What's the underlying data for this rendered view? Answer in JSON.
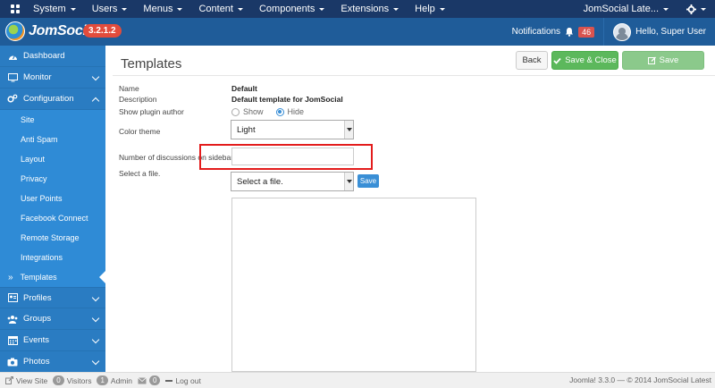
{
  "topmenu": {
    "items": [
      {
        "label": "System"
      },
      {
        "label": "Users"
      },
      {
        "label": "Menus"
      },
      {
        "label": "Content"
      },
      {
        "label": "Components"
      },
      {
        "label": "Extensions"
      },
      {
        "label": "Help"
      }
    ],
    "site_name": "JomSocial Late..."
  },
  "header": {
    "brand": "JomSocial",
    "version": "3.2.1.2",
    "notifications_label": "Notifications",
    "notifications_count": "46",
    "user_greeting": "Hello, Super User"
  },
  "sidebar": {
    "sections": [
      {
        "label": "Dashboard",
        "icon": "dashboard-icon"
      },
      {
        "label": "Monitor",
        "icon": "monitor-icon"
      },
      {
        "label": "Configuration",
        "icon": "cogs-icon"
      }
    ],
    "config_items": [
      {
        "label": "Site"
      },
      {
        "label": "Anti Spam"
      },
      {
        "label": "Layout"
      },
      {
        "label": "Privacy"
      },
      {
        "label": "User Points"
      },
      {
        "label": "Facebook Connect"
      },
      {
        "label": "Remote Storage"
      },
      {
        "label": "Integrations"
      },
      {
        "label": "Templates"
      }
    ],
    "raquo": "»",
    "bottom_sections": [
      {
        "label": "Profiles",
        "icon": "profile-icon"
      },
      {
        "label": "Groups",
        "icon": "groups-icon"
      },
      {
        "label": "Events",
        "icon": "calendar-icon"
      },
      {
        "label": "Photos",
        "icon": "camera-icon"
      }
    ]
  },
  "page": {
    "title": "Templates",
    "toolbar": {
      "back": "Back",
      "save_close": "Save & Close",
      "save": "Save"
    }
  },
  "form": {
    "name_label": "Name",
    "name_value": "Default",
    "description_label": "Description",
    "description_value": "Default template for JomSocial",
    "plugin_author_label": "Show plugin author",
    "plugin_author_show": "Show",
    "plugin_author_hide": "Hide",
    "color_theme_label": "Color theme",
    "color_theme_value": "Light",
    "discussions_label": "Number of discussions on sidebar",
    "discussions_value": "",
    "file_label": "Select a file.",
    "file_select_value": "Select a file.",
    "file_save": "Save"
  },
  "footer": {
    "view_site": "View Site",
    "visitors_count": "0",
    "visitors_label": "Visitors",
    "admin_count": "1",
    "admin_label": "Admin",
    "messages_count": "0",
    "logout": "Log out",
    "copyright": "Joomla! 3.3.0  —  © 2014 JomSocial Latest"
  }
}
